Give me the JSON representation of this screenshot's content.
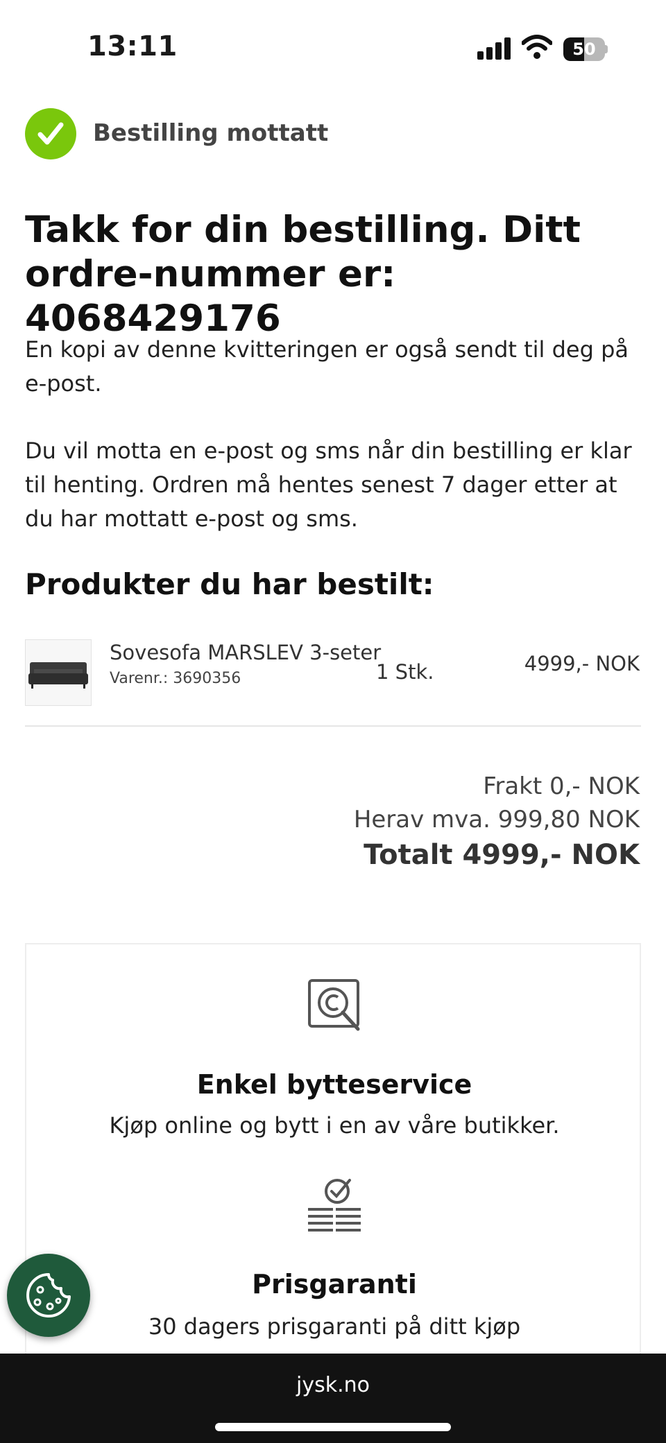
{
  "status_bar": {
    "time": "13:11",
    "battery_level": "50",
    "icons": [
      "cellular-signal-icon",
      "wifi-icon",
      "battery-icon"
    ]
  },
  "header": {
    "status_label": "Bestilling mottatt",
    "status_icon": "check-icon",
    "accent_color": "#7ac70c"
  },
  "confirmation": {
    "title": "Takk for din bestilling. Ditt ordre-nummer er: 4068429176",
    "paragraph1": "En kopi av denne kvitteringen er også sendt til deg på e-post.",
    "paragraph2": "Du vil motta en e-post og sms når din bestilling er klar til henting. Ordren må hentes senest 7 dager etter at du har mottatt e-post og sms."
  },
  "products": {
    "heading": "Produkter du har bestilt:",
    "items": [
      {
        "name": "Sovesofa MARSLEV 3-seter",
        "sku": "Varenr.: 3690356",
        "quantity": "1 Stk.",
        "price": "4999,- NOK",
        "image_icon": "sofa-image"
      }
    ]
  },
  "summary": {
    "shipping": "Frakt 0,- NOK",
    "vat": "Herav mva. 999,80 NOK",
    "total": "Totalt 4999,- NOK"
  },
  "usps": [
    {
      "icon": "search-receipt-icon",
      "title": "Enkel bytteservice",
      "text": "Kjøp online og bytt i en av våre butikker."
    },
    {
      "icon": "price-guarantee-icon",
      "title": "Prisgaranti",
      "text": "30 dagers prisgaranti på ditt kjøp"
    }
  ],
  "cookie_button": {
    "icon": "cookie-icon",
    "color": "#1f5a3b"
  },
  "browser": {
    "url": "jysk.no"
  }
}
